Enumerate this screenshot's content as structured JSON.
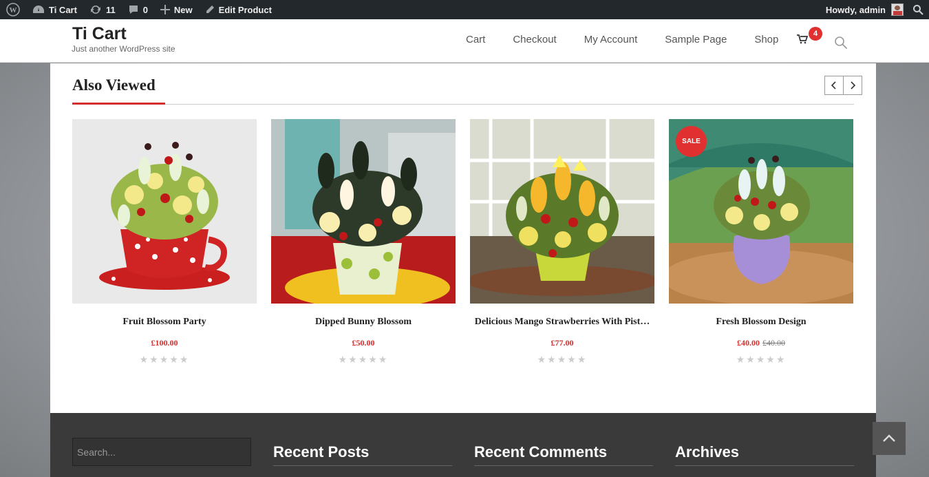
{
  "adminbar": {
    "site_name": "Ti Cart",
    "updates_count": "11",
    "comments_count": "0",
    "new_label": "New",
    "edit_label": "Edit Product",
    "howdy": "Howdy, admin"
  },
  "header": {
    "site_title": "Ti Cart",
    "site_description": "Just another WordPress site",
    "nav": [
      "Cart",
      "Checkout",
      "My Account",
      "Sample Page",
      "Shop"
    ],
    "cart_count": "4"
  },
  "section": {
    "title": "Also Viewed"
  },
  "products": [
    {
      "name": "Fruit Blossom Party",
      "price": "£100.00",
      "old_price": "",
      "sale": false,
      "stars": "★★★★★"
    },
    {
      "name": "Dipped Bunny Blossom",
      "price": "£50.00",
      "old_price": "",
      "sale": false,
      "stars": "★★★★★"
    },
    {
      "name": "Delicious Mango Strawberries With Pist…",
      "price": "£77.00",
      "old_price": "",
      "sale": false,
      "stars": "★★★★★"
    },
    {
      "name": "Fresh Blossom Design",
      "price": "£40.00",
      "old_price": "£40.00",
      "sale": true,
      "sale_label": "SALE",
      "stars": "★★★★★"
    }
  ],
  "footer": {
    "search_placeholder": "Search...",
    "widgets": [
      "Recent Posts",
      "Recent Comments",
      "Archives"
    ]
  },
  "colors": {
    "accent": "#d32f2f",
    "adminbar": "#23282d",
    "footer": "#3a3a3a"
  }
}
